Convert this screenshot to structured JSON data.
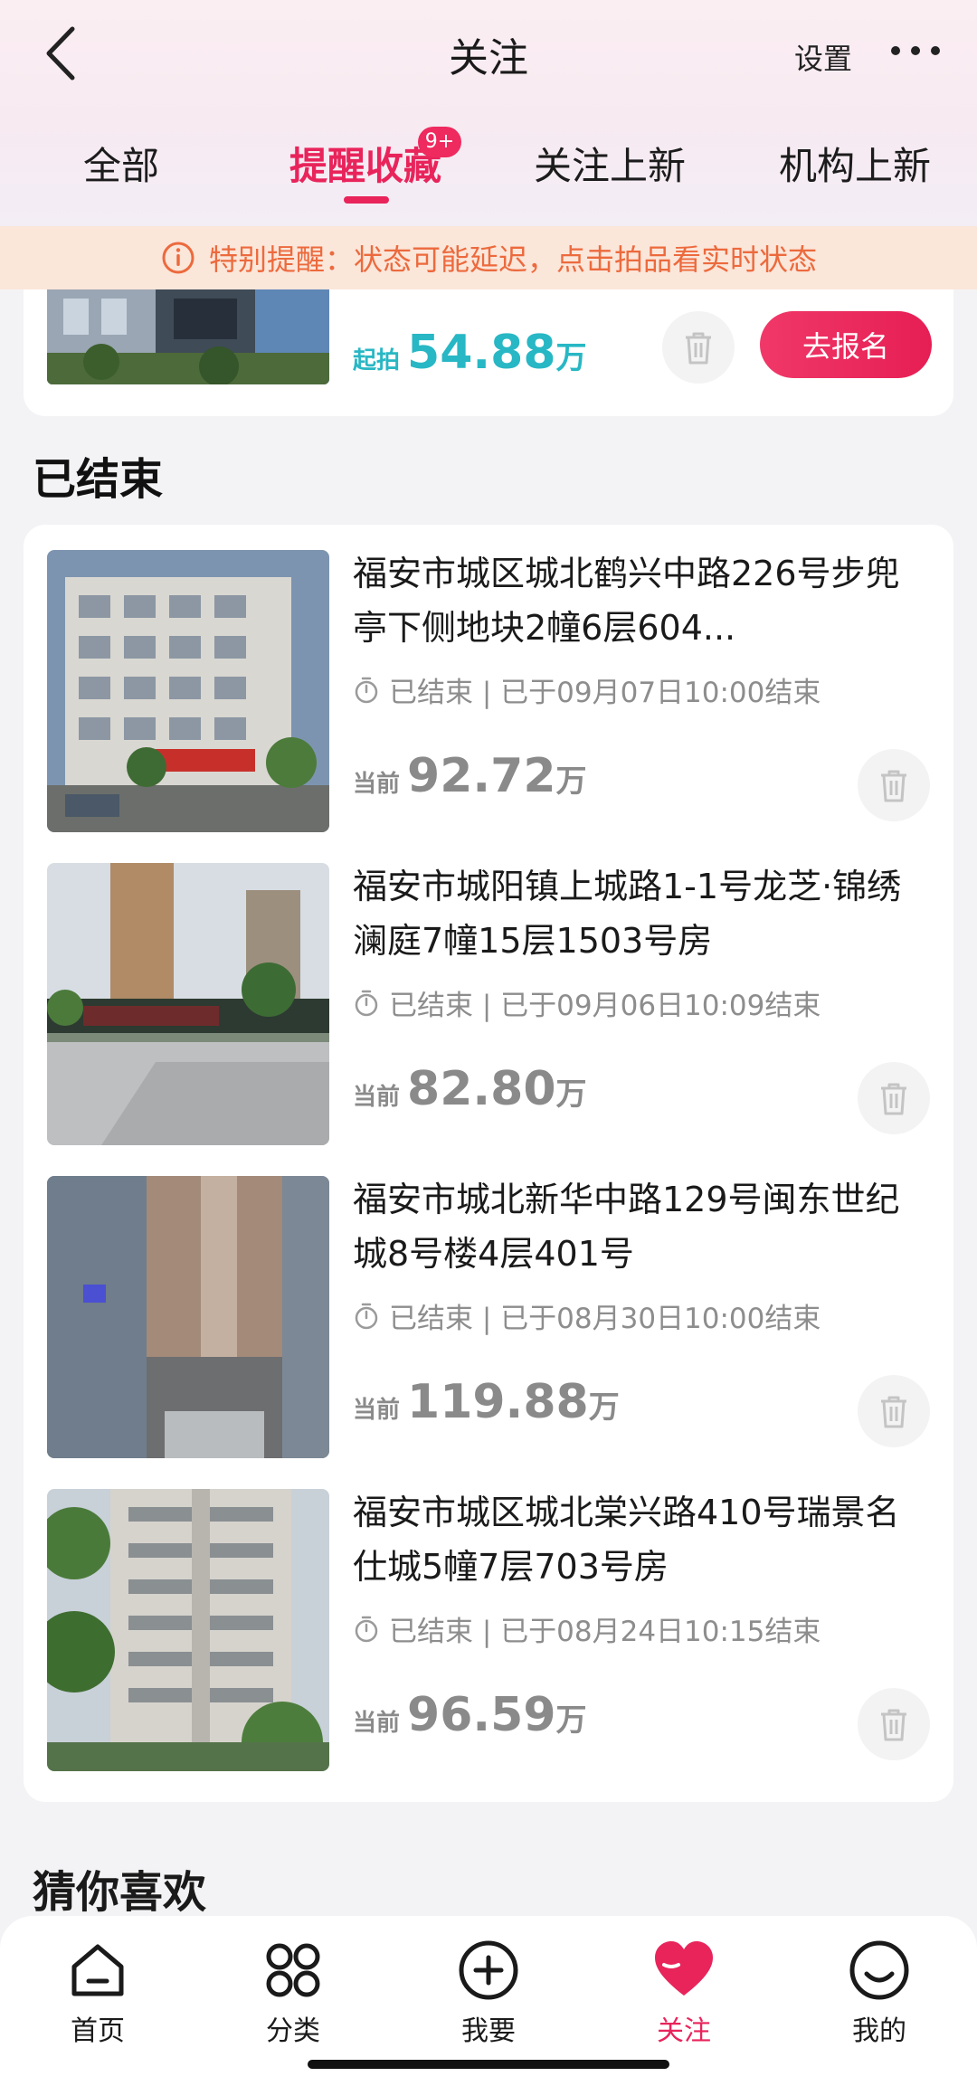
{
  "nav": {
    "title": "关注",
    "settings": "设置"
  },
  "tabs": [
    {
      "label": "全部"
    },
    {
      "label": "提醒收藏",
      "badge": "9+"
    },
    {
      "label": "关注上新"
    },
    {
      "label": "机构上新"
    }
  ],
  "notice": "特别提醒：状态可能延迟，点击拍品看实时状态",
  "active_item": {
    "price_label": "起拍",
    "price": "54.88",
    "unit": "万",
    "signup": "去报名"
  },
  "ended_section": "已结束",
  "items": [
    {
      "title": "福安市城区城北鹤兴中路226号步兜亭下侧地块2幢6层604...",
      "status": "已结束 | 已于09月07日10:00结束",
      "price_label": "当前",
      "price": "92.72",
      "unit": "万"
    },
    {
      "title": "福安市城阳镇上城路1-1号龙芝·锦绣澜庭7幢15层1503号房",
      "status": "已结束 | 已于09月06日10:09结束",
      "price_label": "当前",
      "price": "82.80",
      "unit": "万"
    },
    {
      "title": "福安市城北新华中路129号闽东世纪城8号楼4层401号",
      "status": "已结束 | 已于08月30日10:00结束",
      "price_label": "当前",
      "price": "119.88",
      "unit": "万"
    },
    {
      "title": "福安市城区城北棠兴路410号瑞景名仕城5幢7层703号房",
      "status": "已结束 | 已于08月24日10:15结束",
      "price_label": "当前",
      "price": "96.59",
      "unit": "万"
    }
  ],
  "guess_section": "猜你喜欢",
  "tabbar": [
    {
      "label": "首页",
      "icon": "home-icon"
    },
    {
      "label": "分类",
      "icon": "category-icon"
    },
    {
      "label": "我要",
      "icon": "plus-circle-icon"
    },
    {
      "label": "关注",
      "icon": "heart-icon"
    },
    {
      "label": "我的",
      "icon": "smile-icon"
    }
  ],
  "colors": {
    "accent": "#e8245b",
    "teal": "#28b7c4",
    "notice": "#ec6a3d"
  }
}
